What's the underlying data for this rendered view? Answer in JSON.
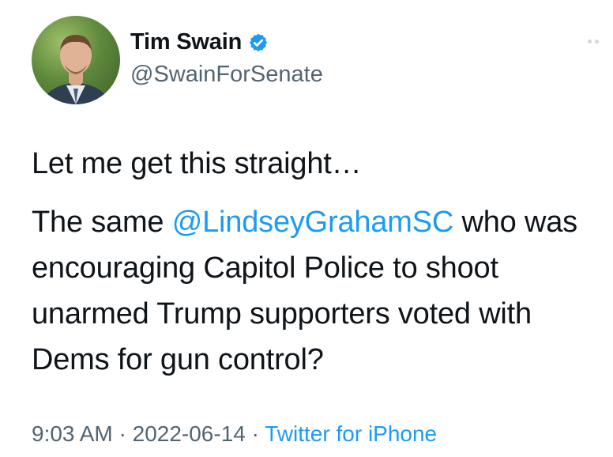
{
  "author": {
    "display_name": "Tim Swain",
    "handle": "@SwainForSenate",
    "verified": true,
    "avatar_icon": "profile-photo"
  },
  "tweet": {
    "line1": "Let me get this straight…",
    "p2_before": "The same ",
    "mention": "@LindseyGrahamSC",
    "p2_after": " who was encouraging Capitol Police to shoot unarmed Trump supporters voted with Dems for gun control?"
  },
  "meta": {
    "time": "9:03 AM",
    "sep1": " · ",
    "date": "2022-06-14",
    "sep2": " · ",
    "source": "Twitter for iPhone"
  },
  "colors": {
    "link": "#1d9bf0",
    "secondary_text": "#536471",
    "primary_text": "#0f1419"
  }
}
